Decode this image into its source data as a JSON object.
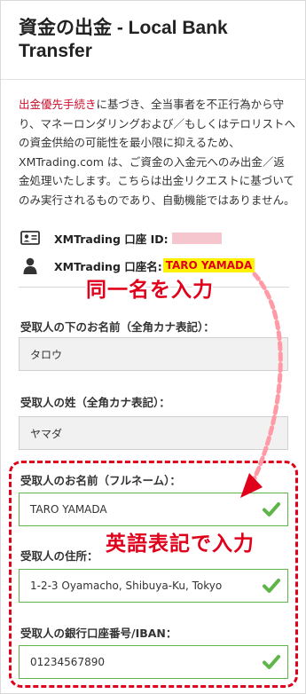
{
  "page": {
    "title": "資金の出金 - Local Bank Transfer"
  },
  "notice": {
    "link_text": "出金優先手続き",
    "body_text": "に基づき、全当事者を不正行為から守り、マネーロンダリングおよび／もしくはテロリストへの資金供給の可能性を最小限に抑えるため、XMTrading.com は、ご資金の入金元へのみ出金／返金処理いたします。こちらは出金リクエストに基づいてのみ実行されるものであり、自動機能ではありません。"
  },
  "account": {
    "id_label": "XMTrading 口座 ID:",
    "name_label": "XMTrading 口座名:",
    "name_value": "TARO YAMADA"
  },
  "annotations": {
    "same_name": "同一名を入力",
    "english_input": "英語表記で入力"
  },
  "form": {
    "given_name_kana": {
      "label": "受取人の下のお名前（全角カナ表記）：",
      "value": "タロウ"
    },
    "family_name_kana": {
      "label": "受取人の姓（全角カナ表記）：",
      "value": "ヤマダ"
    },
    "full_name": {
      "label": "受取人のお名前（フルネーム）：",
      "value": "TARO YAMADA"
    },
    "address": {
      "label": "受取人の住所：",
      "value": "1-2-3 Oyamacho, Shibuya-Ku, Tokyo"
    },
    "account_number": {
      "label": "受取人の銀行口座番号/IBAN：",
      "value": "01234567890"
    }
  },
  "colors": {
    "accent_red": "#e0001b",
    "valid_green": "#5fb548",
    "highlight_yellow": "#fff200",
    "masked_pink": "#f6c6cf"
  },
  "icons": {
    "account_id": "id-card-icon",
    "account_name": "user-icon",
    "valid": "check-icon"
  }
}
